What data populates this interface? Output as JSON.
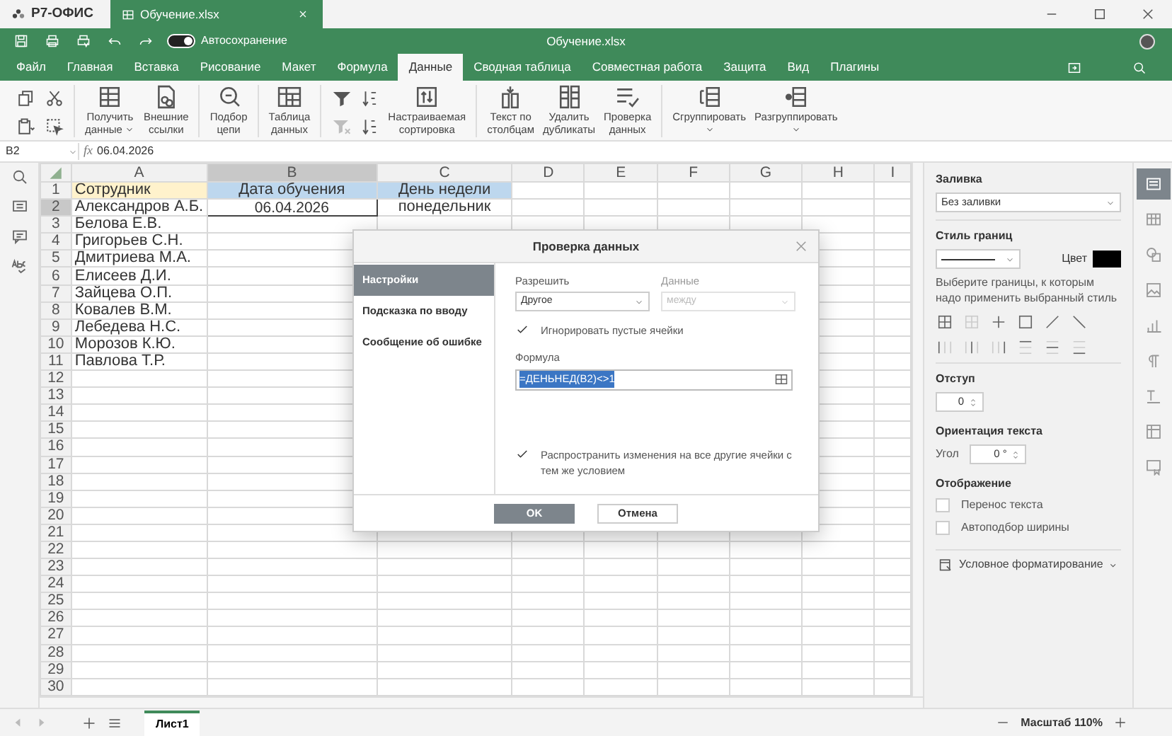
{
  "title_bar": {
    "brand": "Р7-ОФИС",
    "file_tab": "Обучение.xlsx"
  },
  "quick_bar": {
    "autosave_label": "Автосохранение",
    "autosave_on": true,
    "title": "Обучение.xlsx"
  },
  "menu_tabs": [
    {
      "label": "Файл",
      "selected": false
    },
    {
      "label": "Главная",
      "selected": false
    },
    {
      "label": "Вставка",
      "selected": false
    },
    {
      "label": "Рисование",
      "selected": false
    },
    {
      "label": "Макет",
      "selected": false
    },
    {
      "label": "Формула",
      "selected": false
    },
    {
      "label": "Данные",
      "selected": true
    },
    {
      "label": "Сводная таблица",
      "selected": false
    },
    {
      "label": "Совместная работа",
      "selected": false
    },
    {
      "label": "Защита",
      "selected": false
    },
    {
      "label": "Вид",
      "selected": false
    },
    {
      "label": "Плагины",
      "selected": false
    }
  ],
  "toolbar": [
    [
      {
        "kind": "icons",
        "icons": [
          {
            "disabled": false
          },
          {
            "disabled": false
          }
        ]
      },
      {
        "kind": "icons",
        "icons": [
          {
            "disabled": false
          },
          {
            "disabled": false
          }
        ]
      }
    ],
    [
      {
        "kind": "button",
        "lines": [
          "Получить",
          "данные"
        ],
        "dropdown": true
      },
      {
        "kind": "button",
        "lines": [
          "Внешние",
          "ссылки"
        ],
        "dropdown": false
      }
    ],
    [
      {
        "kind": "button",
        "lines": [
          "Подбор",
          "цепи"
        ],
        "dropdown": false
      }
    ],
    [
      {
        "kind": "button",
        "lines": [
          "Таблица",
          "данных"
        ],
        "dropdown": false
      }
    ],
    [
      {
        "kind": "icons",
        "icons": [
          {
            "disabled": false
          },
          {
            "disabled": true
          }
        ]
      },
      {
        "kind": "icons",
        "icons": [
          {
            "disabled": false
          },
          {
            "disabled": false
          }
        ]
      },
      {
        "kind": "button",
        "lines": [
          "Настраиваемая",
          "сортировка"
        ],
        "dropdown": false
      }
    ],
    [
      {
        "kind": "button",
        "lines": [
          "Текст по",
          "столбцам"
        ],
        "dropdown": false
      },
      {
        "kind": "button",
        "lines": [
          "Удалить",
          "дубликаты"
        ],
        "dropdown": false
      },
      {
        "kind": "button",
        "lines": [
          "Проверка",
          "данных"
        ],
        "dropdown": false
      }
    ],
    [
      {
        "kind": "button",
        "lines": [
          "Сгруппировать"
        ],
        "dropdown": true
      },
      {
        "kind": "button",
        "lines": [
          "Разгруппировать"
        ],
        "dropdown": true
      }
    ]
  ],
  "formula_bar": {
    "cell_ref": "B2",
    "fx": "fx",
    "value": "06.04.2026"
  },
  "grid": {
    "columns": [
      {
        "label": "A",
        "selected": false
      },
      {
        "label": "B",
        "selected": true
      },
      {
        "label": "C",
        "selected": false
      },
      {
        "label": "D",
        "selected": false
      },
      {
        "label": "E",
        "selected": false
      },
      {
        "label": "F",
        "selected": false
      },
      {
        "label": "G",
        "selected": false
      },
      {
        "label": "H",
        "selected": false
      },
      {
        "label": "I",
        "selected": false
      }
    ],
    "rows": [
      {
        "number": "1",
        "selected": false,
        "cells": [
          {
            "text": "Сотрудник",
            "color": "#fff2cc"
          },
          {
            "text": "Дата обучения",
            "color": "#bdd7ee"
          },
          {
            "text": "День недели",
            "color": "#bdd7ee"
          }
        ]
      },
      {
        "number": "2",
        "selected": true,
        "cells": [
          {
            "text": "Александров А.Б."
          },
          {
            "text": "06.04.2026"
          },
          {
            "text": "понедельник"
          }
        ]
      },
      {
        "number": "3",
        "selected": false,
        "cells": [
          {
            "text": "Белова Е.В."
          }
        ]
      },
      {
        "number": "4",
        "selected": false,
        "cells": [
          {
            "text": "Григорьев С.Н."
          }
        ]
      },
      {
        "number": "5",
        "selected": false,
        "cells": [
          {
            "text": "Дмитриева М.А."
          }
        ]
      },
      {
        "number": "6",
        "selected": false,
        "cells": [
          {
            "text": "Елисеев Д.И."
          }
        ]
      },
      {
        "number": "7",
        "selected": false,
        "cells": [
          {
            "text": "Зайцева О.П."
          }
        ]
      },
      {
        "number": "8",
        "selected": false,
        "cells": [
          {
            "text": "Ковалев В.М."
          }
        ]
      },
      {
        "number": "9",
        "selected": false,
        "cells": [
          {
            "text": "Лебедева Н.С."
          }
        ]
      },
      {
        "number": "10",
        "selected": false,
        "cells": [
          {
            "text": "Морозов К.Ю."
          }
        ]
      },
      {
        "number": "11",
        "selected": false,
        "cells": [
          {
            "text": "Павлова Т.Р."
          }
        ]
      },
      {
        "number": "12",
        "selected": false
      },
      {
        "number": "13",
        "selected": false
      },
      {
        "number": "14",
        "selected": false
      },
      {
        "number": "15",
        "selected": false
      },
      {
        "number": "16",
        "selected": false
      },
      {
        "number": "17",
        "selected": false
      },
      {
        "number": "18",
        "selected": false
      },
      {
        "number": "19",
        "selected": false
      },
      {
        "number": "20",
        "selected": false
      },
      {
        "number": "21",
        "selected": false
      },
      {
        "number": "22",
        "selected": false
      },
      {
        "number": "23",
        "selected": false
      },
      {
        "number": "24",
        "selected": false
      },
      {
        "number": "25",
        "selected": false
      },
      {
        "number": "26",
        "selected": false
      },
      {
        "number": "27",
        "selected": false
      },
      {
        "number": "28",
        "selected": false
      },
      {
        "number": "29",
        "selected": false
      },
      {
        "number": "30",
        "selected": false
      }
    ]
  },
  "dialog": {
    "title": "Проверка данных",
    "menu": [
      {
        "label": "Настройки",
        "selected": true
      },
      {
        "label": "Подсказка по вводу",
        "selected": false
      },
      {
        "label": "Сообщение об ошибке",
        "selected": false
      }
    ],
    "allow": {
      "label": "Разрешить",
      "value": "Другое",
      "disabled": false
    },
    "data": {
      "label": "Данные",
      "value": "между",
      "disabled": true
    },
    "ignore_blank": {
      "label": "Игнорировать пустые ячейки",
      "checked": true
    },
    "formula": {
      "label": "Формула",
      "value": "=ДЕНЬНЕД(B2)<>1",
      "highlighted": true
    },
    "apply_all": {
      "label": "Распространить изменения на все другие ячейки с тем же условием",
      "checked": true
    },
    "buttons": [
      {
        "label": "OK",
        "kind": "primary"
      },
      {
        "label": "Отмена",
        "kind": "secondary"
      }
    ]
  },
  "right_panel": {
    "fill": {
      "title": "Заливка",
      "value": "Без заливки"
    },
    "border_style": {
      "title": "Стиль границ",
      "color_label": "Цвет",
      "color": "#000000",
      "hint": "Выберите границы, к которым надо применить выбранный стиль"
    },
    "indent": {
      "title": "Отступ",
      "value": "0"
    },
    "orientation": {
      "title": "Ориентация текста",
      "angle_label": "Угол",
      "value": "0 °"
    },
    "display": {
      "title": "Отображение",
      "options": [
        {
          "label": "Перенос текста",
          "checked": false
        },
        {
          "label": "Автоподбор ширины",
          "checked": false
        }
      ]
    },
    "conditional": "Условное форматирование"
  },
  "right_tabs": [
    {
      "selected": true
    },
    {
      "selected": false
    },
    {
      "selected": false
    },
    {
      "selected": false
    },
    {
      "selected": false
    },
    {
      "selected": false
    },
    {
      "selected": false
    },
    {
      "selected": false
    },
    {
      "selected": false
    }
  ],
  "sheet_tabs": [
    {
      "label": "Лист1",
      "selected": true
    }
  ],
  "zoom": "Масштаб 110%"
}
